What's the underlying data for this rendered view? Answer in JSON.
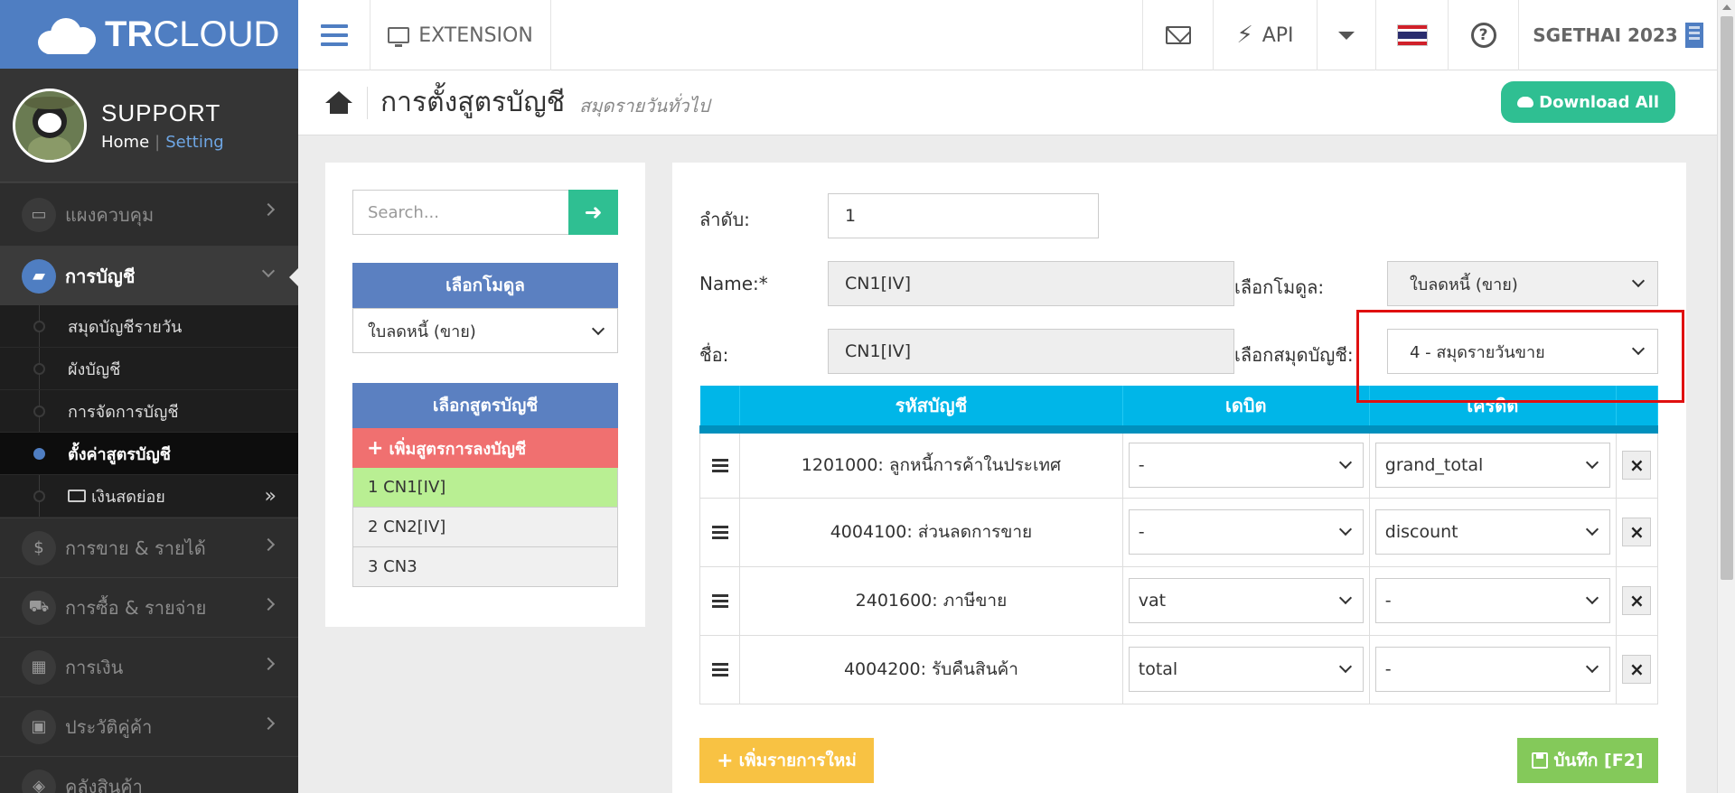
{
  "brand": {
    "logo_bold": "TR",
    "logo_light": "CLOUD"
  },
  "profile": {
    "name": "SUPPORT",
    "home_link": "Home",
    "separator": "|",
    "setting_link": "Setting"
  },
  "sidebar": {
    "menu_top": {
      "label": "แผงควบคุม",
      "icon": "monitor-icon"
    },
    "menu_accounting": {
      "label": "การบัญชี",
      "icon": "book-icon"
    },
    "submenu": [
      {
        "label": "สมุดบัญชีรายวัน"
      },
      {
        "label": "ผังบัญชี"
      },
      {
        "label": "การจัดการบัญชี"
      },
      {
        "label": "ตั้งค่าสูตรบัญชี"
      },
      {
        "label": "เงินสดย่อย"
      }
    ],
    "menu_bottom": [
      {
        "label": "การขาย & รายได้",
        "icon": "dollar-icon"
      },
      {
        "label": "การซื้อ & รายจ่าย",
        "icon": "cart-icon"
      },
      {
        "label": "การเงิน",
        "icon": "calendar-icon"
      },
      {
        "label": "ประวัติคู่ค้า",
        "icon": "contact-icon"
      },
      {
        "label": "คลังสินค้า",
        "icon": "box-icon"
      }
    ]
  },
  "topbar": {
    "extension_label": "EXTENSION",
    "api_label": "API",
    "company": "SGETHAI 2023"
  },
  "header": {
    "title": "การตั้งสูตรบัญชี",
    "subtitle": "สมุดรายวันทั่วไป",
    "download_label": "Download All"
  },
  "left_panel": {
    "search_placeholder": "Search...",
    "module_header": "เลือกโมดูล",
    "module_value": "ใบลดหนี้ (ขาย)",
    "formula_header": "เลือกสูตรบัญชี",
    "add_formula_label": "เพิ่มสูตรการลงบัญชี",
    "formulas": [
      {
        "label": "1  CN1[IV]"
      },
      {
        "label": "2  CN2[IV]"
      },
      {
        "label": "3  CN3"
      }
    ]
  },
  "form": {
    "order_label": "ลำดับ:",
    "order_value": "1",
    "name_label": "Name:*",
    "name_value": "CN1[IV]",
    "thai_name_label": "ชื่อ:",
    "thai_name_value": "CN1[IV]",
    "module_label": "เลือกโมดูล:",
    "module_value": "ใบลดหนี้ (ขาย)",
    "journal_label": "เลือกสมุดบัญชี:",
    "journal_value": "4 - สมุดรายวันขาย"
  },
  "table": {
    "headers": [
      "รหัสบัญชี",
      "เดบิต",
      "เครดิต"
    ],
    "rows": [
      {
        "account": "1201000: ลูกหนี้การค้าในประเทศ",
        "debit": "-",
        "credit": "grand_total"
      },
      {
        "account": "4004100: ส่วนลดการขาย",
        "debit": "-",
        "credit": "discount"
      },
      {
        "account": "2401600: ภาษีขาย",
        "debit": "vat",
        "credit": "-"
      },
      {
        "account": "4004200: รับคืนสินค้า",
        "debit": "total",
        "credit": "-"
      }
    ]
  },
  "actions": {
    "add_row_label": "เพิ่มรายการใหม่",
    "save_label": "บันทึก [F2]"
  },
  "colors": {
    "brand_blue": "#4f7ec2",
    "table_header": "#00b6e8",
    "green": "#2fbf92",
    "highlight": "#e01010"
  }
}
